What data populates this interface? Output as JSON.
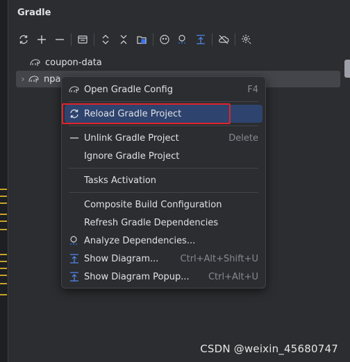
{
  "panel": {
    "title": "Gradle"
  },
  "toolbar": {
    "buttons": [
      {
        "name": "reload-all-icon"
      },
      {
        "name": "add-icon"
      },
      {
        "name": "remove-icon"
      },
      {
        "name": "open-config-icon"
      },
      {
        "name": "expand-all-icon"
      },
      {
        "name": "collapse-all-icon"
      },
      {
        "name": "link-project-icon"
      },
      {
        "name": "offline-mode-icon"
      },
      {
        "name": "analyze-icon"
      },
      {
        "name": "show-diagram-icon"
      },
      {
        "name": "toggle-offline-icon"
      },
      {
        "name": "settings-icon"
      }
    ]
  },
  "tree": {
    "items": [
      {
        "label": "coupon-data"
      },
      {
        "label": "npa"
      }
    ]
  },
  "menu": {
    "items": [
      {
        "label": "Open Gradle Config",
        "shortcut": "F4"
      },
      {
        "label": "Reload Gradle Project",
        "shortcut": ""
      },
      {
        "label": "Unlink Gradle Project",
        "shortcut": "Delete"
      },
      {
        "label": "Ignore Gradle Project",
        "shortcut": ""
      },
      {
        "label": "Tasks Activation",
        "shortcut": ""
      },
      {
        "label": "Composite Build Configuration",
        "shortcut": ""
      },
      {
        "label": "Refresh Gradle Dependencies",
        "shortcut": ""
      },
      {
        "label": "Analyze Dependencies...",
        "shortcut": ""
      },
      {
        "label": "Show Diagram...",
        "shortcut": "Ctrl+Alt+Shift+U"
      },
      {
        "label": "Show Diagram Popup...",
        "shortcut": "Ctrl+Alt+U"
      }
    ]
  },
  "watermark": "CSDN @weixin_45680747",
  "colors": {
    "accent": "#2e436e",
    "highlight_border": "#e0242b",
    "background": "#2b2d30"
  }
}
